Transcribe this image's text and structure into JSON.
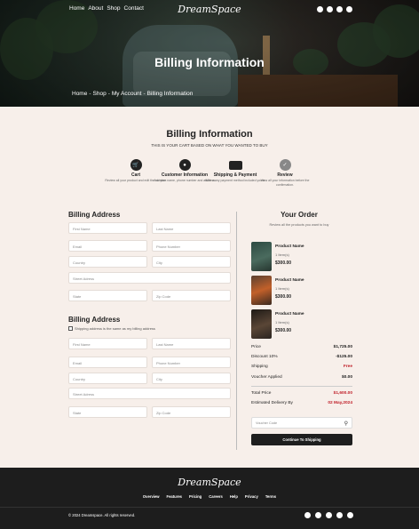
{
  "header": {
    "nav": [
      "Home",
      "About",
      "Shop",
      "Contact"
    ],
    "logo": "DreamSpace",
    "icons": [
      "search-icon",
      "account-icon",
      "cart-icon",
      "user-icon"
    ]
  },
  "hero": {
    "title": "Billing Information",
    "breadcrumb": [
      "Home",
      "Shop",
      "My Account",
      "Billing Information"
    ],
    "breadcrumb_sep": "-"
  },
  "main": {
    "title": "Billing Information",
    "subtitle": "THIS IS YOUR CART BASED ON WHAT YOU WANTED TO BUY",
    "steps": [
      {
        "icon": "cart-icon",
        "title": "Cart",
        "desc": "Review all your product and edit the number."
      },
      {
        "icon": "user-icon",
        "title": "Customer Information",
        "desc": "Add your name, phone number and address."
      },
      {
        "icon": "credit-card-icon",
        "title": "Shipping & Payment",
        "desc": "With many payment method included yours."
      },
      {
        "icon": "review-icon",
        "title": "Review",
        "desc": "View all your information before the confirmation."
      }
    ],
    "billing_address": {
      "heading": "Billing Address",
      "first_name": "First Name",
      "last_name": "Last Name",
      "email": "Email",
      "phone": "Phone Number",
      "country": "Country",
      "city": "City",
      "street": "Street Adress",
      "state": "State",
      "zip": "Zip Code"
    },
    "billing_address_2": {
      "heading": "Billing Address",
      "same_as_billing": "Shipping address is the same as my billing address",
      "first_name": "First Name",
      "last_name": "Last Name",
      "email": "Email",
      "phone": "Phone Number",
      "country": "Country",
      "city": "City",
      "street": "Street Adress",
      "state": "State",
      "zip": "Zip Code"
    }
  },
  "order": {
    "heading": "Your Order",
    "subtitle": "Review all the products you want to buy",
    "items": [
      {
        "name": "Product Name",
        "qty": "1 Item(s)",
        "price": "$300.00",
        "color": "#3d5a4e"
      },
      {
        "name": "Product Name",
        "qty": "1 Item(s)",
        "price": "$300.00",
        "color": "#b85a2a"
      },
      {
        "name": "Product Name",
        "qty": "1 Item(s)",
        "price": "$300.00",
        "color": "#3a2e26"
      }
    ],
    "summary": [
      {
        "label": "Price",
        "value": "$1,725.00",
        "red": false
      },
      {
        "label": "Discount 10%",
        "value": "-$125.00",
        "red": false
      },
      {
        "label": "Shipping",
        "value": "Free",
        "red": true
      },
      {
        "label": "Voucher Applied",
        "value": "$0.00",
        "red": false
      }
    ],
    "total": [
      {
        "label": "Total Price",
        "value": "$1,600.00",
        "red": true
      },
      {
        "label": "Estimated Delivery By",
        "value": "02 May,2024",
        "red": true
      }
    ],
    "voucher_placeholder": "Voucher Code",
    "continue_label": "Continue To Shipping"
  },
  "footer": {
    "logo": "DreamSpace",
    "nav": [
      "Overview",
      "Features",
      "Pricing",
      "Careers",
      "Help",
      "Privacy",
      "Terms"
    ],
    "copyright": "© 2024 Dreamspace. All rights reserved.",
    "social": [
      "facebook-icon",
      "youtube-icon",
      "linkedin-icon",
      "tiktok-icon",
      "instagram-icon"
    ]
  },
  "colors": {
    "accent": "#1e1e1e",
    "highlight": "#c0202a",
    "background": "#f7efea"
  }
}
